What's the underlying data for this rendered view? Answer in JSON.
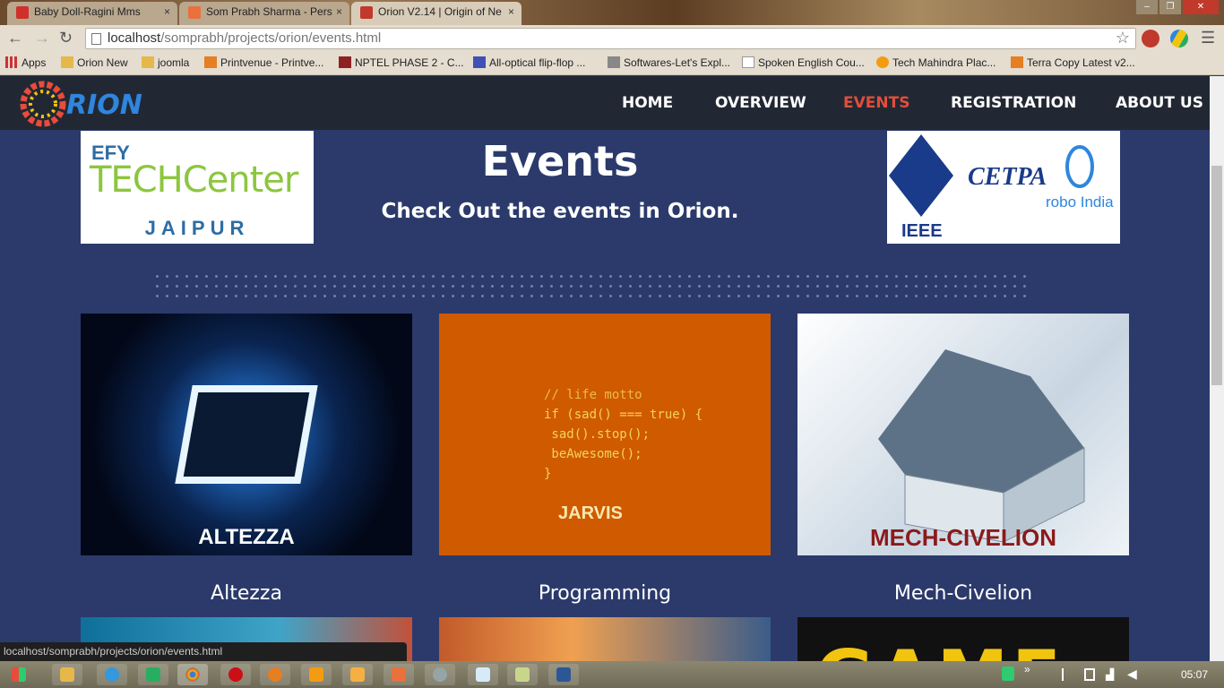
{
  "browser": {
    "tabs": [
      {
        "title": "Baby Doll-Ragini Mms",
        "color": "#d0302a"
      },
      {
        "title": "Som Prabh Sharma - Pers",
        "color": "#e9713c"
      },
      {
        "title": "Orion V2.14 | Origin of Ne",
        "color": "#c0392b"
      }
    ],
    "url_host": "localhost",
    "url_path": "/somprabh/projects/orion/events.html",
    "bookmarks": [
      "Apps",
      "Orion New",
      "joomla",
      "Printvenue - Printve...",
      "NPTEL PHASE 2 - C...",
      "All-optical flip-flop ...",
      "Softwares-Let's Expl...",
      "Spoken English Cou...",
      "Tech Mahindra Plac...",
      "Terra Copy Latest v2..."
    ]
  },
  "site": {
    "logo_text": "ORION",
    "nav": [
      "HOME",
      "OVERVIEW",
      "EVENTS",
      "REGISTRATION",
      "ABOUT US"
    ],
    "active_nav": "EVENTS",
    "title": "Events",
    "subtitle": "Check Out the events in Orion.",
    "sponsor_left": {
      "line1": "EFY",
      "line2": "TECHCenter",
      "line3": "JAIPUR"
    },
    "sponsor_right": {
      "a": "IEEE",
      "b": "CETPA",
      "c": "robo India"
    },
    "events": [
      {
        "image_text": "ALTEZZA",
        "label": "Altezza"
      },
      {
        "image_text": "JARVIS",
        "label": "Programming",
        "code": [
          "// life motto",
          "if (sad() === true) {",
          " sad().stop();",
          " beAwesome();",
          "}"
        ]
      },
      {
        "image_text": "MECH-CIVELION",
        "label": "Mech-Civelion"
      }
    ],
    "partial_card_text": "GAME"
  },
  "status_url": "localhost/somprabh/projects/orion/events.html",
  "clock": "05:07"
}
